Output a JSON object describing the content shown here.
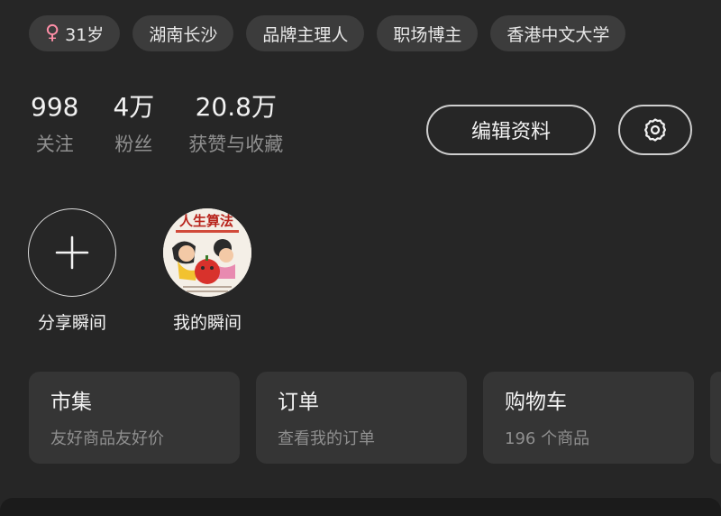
{
  "tags": [
    {
      "icon": "female-icon",
      "icon_glyph": "♀",
      "label": "31岁"
    },
    {
      "label": "湖南长沙"
    },
    {
      "label": "品牌主理人"
    },
    {
      "label": "职场博主"
    },
    {
      "label": "香港中文大学"
    }
  ],
  "stats": [
    {
      "value": "998",
      "label": "关注"
    },
    {
      "value": "4万",
      "label": "粉丝"
    },
    {
      "value": "20.8万",
      "label": "获赞与收藏"
    }
  ],
  "actions": {
    "edit_profile": "编辑资料",
    "settings_icon": "gear-icon"
  },
  "moments": {
    "share": {
      "label": "分享瞬间",
      "icon": "plus-icon"
    },
    "mine": {
      "label": "我的瞬间",
      "cover_title": "人生算法"
    }
  },
  "cards": [
    {
      "title": "市集",
      "subtitle": "友好商品友好价"
    },
    {
      "title": "订单",
      "subtitle": "查看我的订单"
    },
    {
      "title": "购物车",
      "subtitle": "196 个商品"
    }
  ],
  "colors": {
    "background": "#262626",
    "chip": "#3c3c3c",
    "card": "#353535",
    "muted_text": "#8f8f8f",
    "gender_accent": "#ff8fa8"
  }
}
